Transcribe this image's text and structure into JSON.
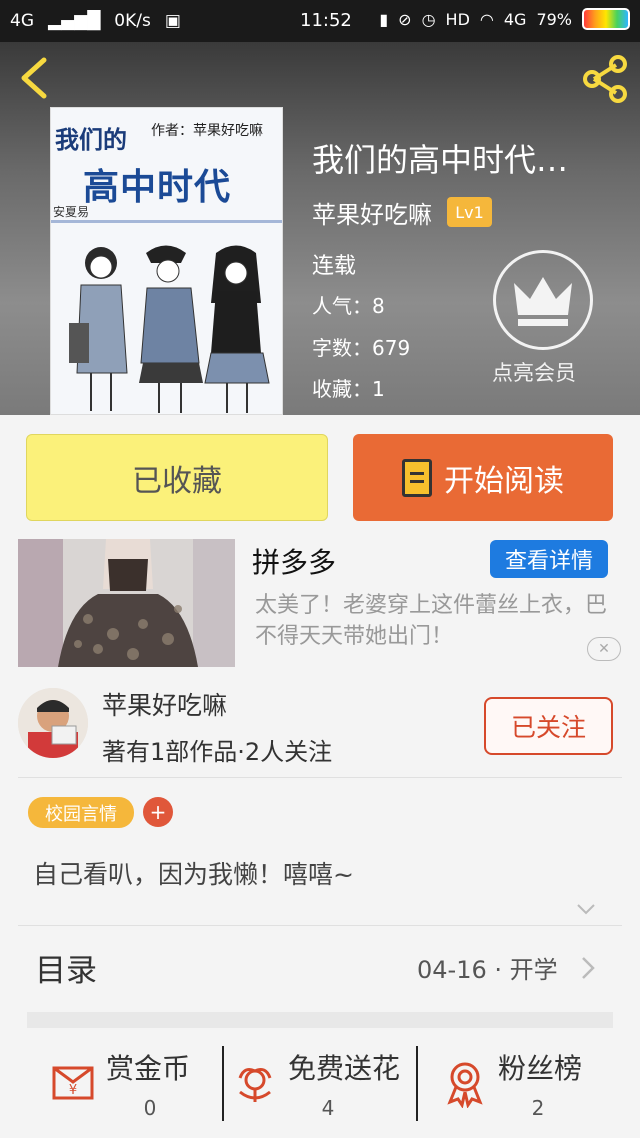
{
  "status_bar": {
    "network": "4G",
    "speed": "0K/s",
    "time": "11:52",
    "hd": "HD",
    "network2": "4G",
    "battery": "79%"
  },
  "book": {
    "title": "我们的高中时代…",
    "author": "苹果好吃嘛",
    "level": "Lv1",
    "status": "连载",
    "popularity_label": "人气：",
    "popularity": "8",
    "words_label": "字数：",
    "words": "679",
    "favorites_label": "收藏：",
    "favorites": "1",
    "vip_label": "点亮会员",
    "cover": {
      "title_top": "我们的",
      "author_line": "作者：苹果好吃嘛",
      "title_main": "高中时代",
      "small": "安夏易"
    }
  },
  "actions": {
    "collected": "已收藏",
    "start_reading": "开始阅读"
  },
  "ad": {
    "title": "拼多多",
    "detail_button": "查看详情",
    "description": "太美了！老婆穿上这件蕾丝上衣，巴不得天天带她出门！",
    "close": "✕"
  },
  "author_card": {
    "name": "苹果好吃嘛",
    "info": "著有1部作品·2人关注",
    "follow_button": "已关注"
  },
  "tags": [
    "校园言情"
  ],
  "tag_add": "+",
  "intro": "自己看叭，因为我懒！嘻嘻~",
  "catalog": {
    "label": "目录",
    "latest": "04-16 · 开学"
  },
  "bottom": [
    {
      "label": "赏金币",
      "count": "0",
      "icon": "coin-envelope-icon"
    },
    {
      "label": "免费送花",
      "count": "4",
      "icon": "flower-icon"
    },
    {
      "label": "粉丝榜",
      "count": "2",
      "icon": "medal-icon"
    }
  ],
  "colors": {
    "collected_bg": "#fbf17a",
    "read_bg": "#e96a35",
    "level_badge": "#f5b73b",
    "detail_btn": "#1e7be0",
    "follow": "#d6492b",
    "icon_red": "#d6492b"
  }
}
